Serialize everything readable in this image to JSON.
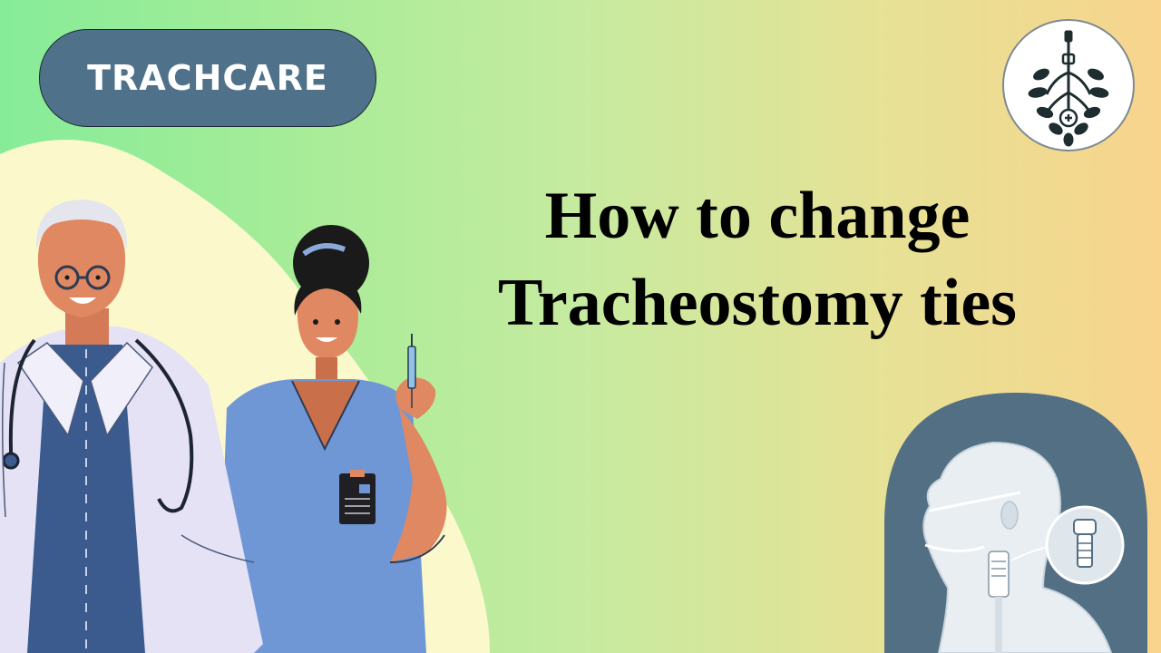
{
  "brand": {
    "label": "TRACHCARE"
  },
  "title": {
    "line1": "How to change",
    "line2": "Tracheostomy ties"
  },
  "icons": {
    "logo": "tracheostomy-leaves-logo-icon",
    "doctor": "doctor-illustration",
    "nurse": "nurse-illustration",
    "trach": "tracheostomy-head-illustration"
  },
  "colors": {
    "pill": "#4f7189",
    "gradient_left": "#86ec98",
    "gradient_right": "#f8d48d",
    "blob": "#fbf9cc",
    "nurse_scrubs": "#6f97d6",
    "skin": "#e08862"
  }
}
